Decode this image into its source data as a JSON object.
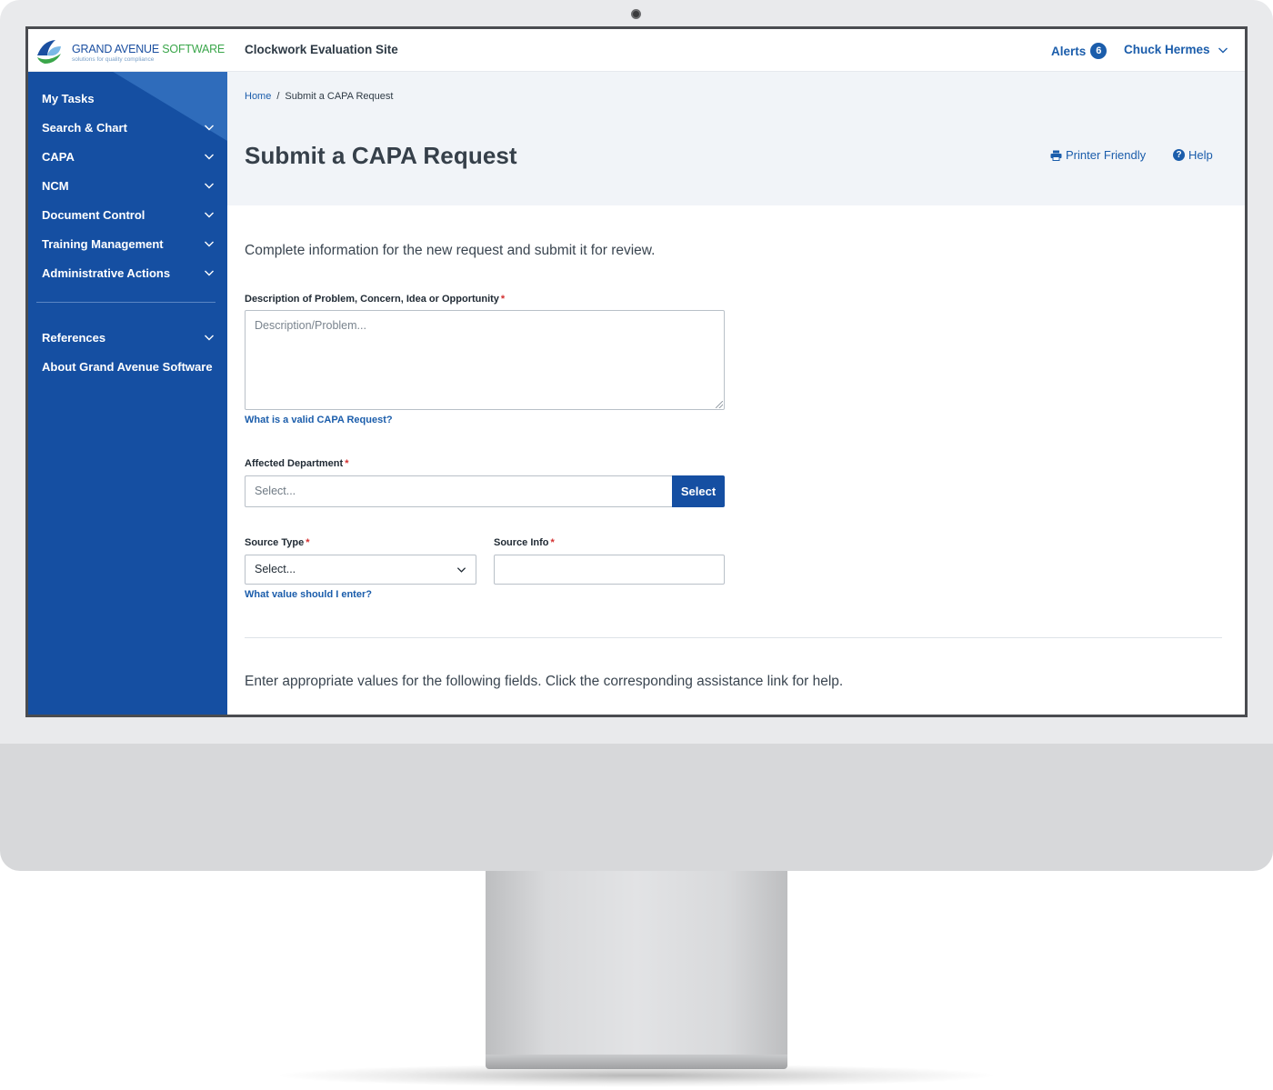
{
  "header": {
    "logo_name": "GRAND AVENUE",
    "logo_name_accent": "SOFTWARE",
    "logo_tagline": "solutions for quality compliance",
    "site_name": "Clockwork Evaluation Site",
    "alerts_label": "Alerts",
    "alerts_count": "6",
    "user_name": "Chuck Hermes"
  },
  "sidebar": {
    "items": [
      {
        "label": "My Tasks",
        "expandable": false
      },
      {
        "label": "Search & Chart",
        "expandable": true
      },
      {
        "label": "CAPA",
        "expandable": true
      },
      {
        "label": "NCM",
        "expandable": true
      },
      {
        "label": "Document Control",
        "expandable": true
      },
      {
        "label": "Training Management",
        "expandable": true
      },
      {
        "label": "Administrative Actions",
        "expandable": true
      }
    ],
    "secondary_items": [
      {
        "label": "References",
        "expandable": true
      },
      {
        "label": "About Grand Avenue Software",
        "expandable": false
      }
    ]
  },
  "breadcrumb": {
    "home": "Home",
    "separator": "/",
    "current": "Submit a CAPA Request"
  },
  "page": {
    "title": "Submit a CAPA Request",
    "printer_friendly": "Printer Friendly",
    "help": "Help",
    "help_icon_glyph": "?",
    "intro": "Complete information for the new request and submit it for review.",
    "outro": "Enter appropriate values for the following fields. Click the corresponding assistance link for help."
  },
  "form": {
    "required_marker": "*",
    "description": {
      "label": "Description of Problem, Concern, Idea or Opportunity",
      "placeholder": "Description/Problem...",
      "help_link": "What is a valid CAPA Request?"
    },
    "department": {
      "label": "Affected Department",
      "placeholder": "Select...",
      "button": "Select"
    },
    "source_type": {
      "label": "Source Type",
      "selected": "Select...",
      "help_link": "What value should I enter?"
    },
    "source_info": {
      "label": "Source Info",
      "value": ""
    }
  },
  "colors": {
    "sidebar": "#154fa2",
    "link": "#1b5dab",
    "required": "#d32f2f",
    "header_band": "#f1f4f8"
  },
  "icons": [
    "logo-icon",
    "chevron-down-icon",
    "printer-icon",
    "help-icon"
  ]
}
